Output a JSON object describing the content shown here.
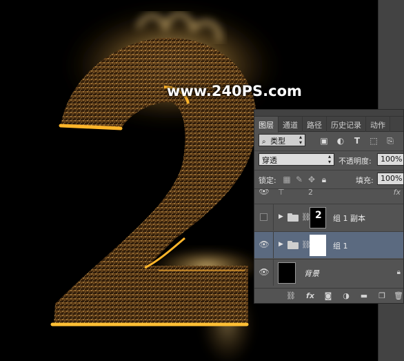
{
  "watermark": "www.240PS.com",
  "colors": {
    "canvas_bg": "#000000",
    "panel_bg": "#535353",
    "tab_bar_bg": "#424242",
    "selected_row": "#5b6a80",
    "glow": "#ffcf6a",
    "gold": "#d89a1e"
  },
  "panel": {
    "tabs": [
      {
        "label": "图层",
        "active": true
      },
      {
        "label": "通道",
        "active": false
      },
      {
        "label": "路径",
        "active": false
      },
      {
        "label": "历史记录",
        "active": false
      },
      {
        "label": "动作",
        "active": false
      }
    ],
    "filter": {
      "search_icon": "search-icon",
      "kind": "类型"
    },
    "filter_icons": [
      "image-filter-icon",
      "adjustment-filter-icon",
      "text-filter-icon",
      "shape-filter-icon",
      "smart-object-filter-icon"
    ],
    "blend_mode": "穿透",
    "opacity_label": "不透明度:",
    "opacity_value": "100%",
    "lock_label": "锁定:",
    "lock_icons": [
      "lock-transparent-icon",
      "lock-paint-icon",
      "lock-move-icon",
      "lock-all-icon"
    ],
    "fill_label": "填充:",
    "fill_value": "100%",
    "partial_row": {
      "number": "2",
      "fx": "fx"
    },
    "layers": [
      {
        "name": "组 1 副本",
        "visible": false,
        "type": "group",
        "mask": "black-with-2"
      },
      {
        "name": "组 1",
        "visible": true,
        "type": "group",
        "mask": "white",
        "selected": true
      },
      {
        "name": "背景",
        "visible": true,
        "type": "background",
        "locked": true
      }
    ],
    "bottom_icons": [
      "link-layers-icon",
      "fx-icon",
      "add-mask-icon",
      "adjustment-layer-icon",
      "new-group-icon",
      "new-layer-icon",
      "delete-icon"
    ],
    "fx_label": "fx"
  }
}
